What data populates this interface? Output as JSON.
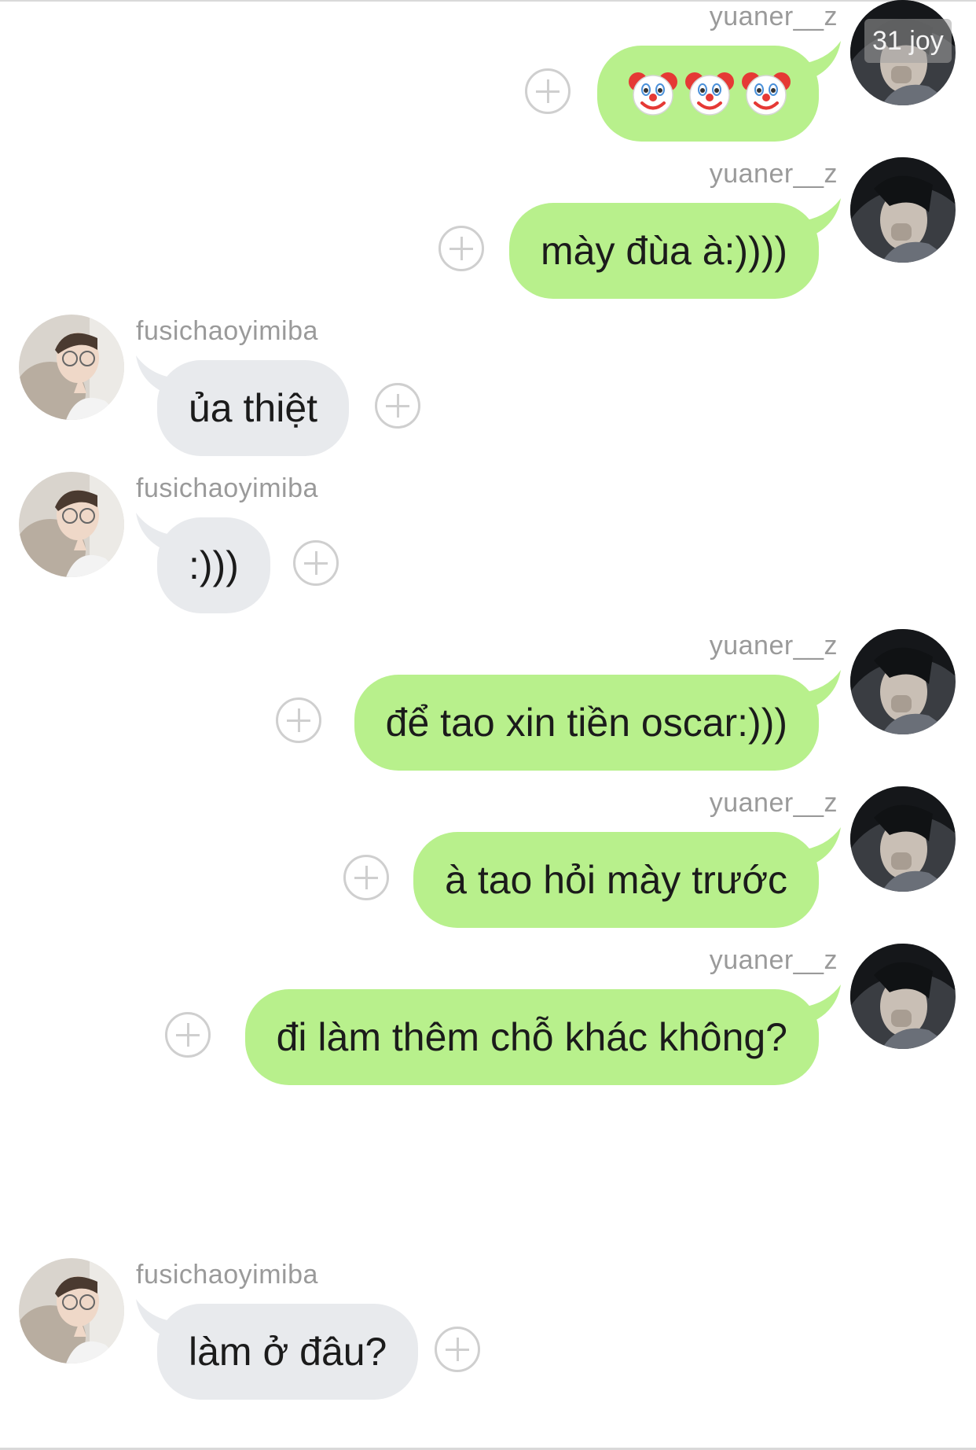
{
  "watermark": "31 joy",
  "users": {
    "me": "yuaner__z",
    "other": "fusichaoyimiba"
  },
  "messages": [
    {
      "side": "right",
      "sender": "yuaner__z",
      "text": "",
      "emoji": [
        "clown-face",
        "clown-face",
        "clown-face"
      ]
    },
    {
      "side": "right",
      "sender": "yuaner__z",
      "text": "mày đùa à:))))"
    },
    {
      "side": "left",
      "sender": "fusichaoyimiba",
      "text": "ủa thiệt"
    },
    {
      "side": "left",
      "sender": "fusichaoyimiba",
      "text": ":)))"
    },
    {
      "side": "right",
      "sender": "yuaner__z",
      "text": "để tao xin tiền oscar:)))"
    },
    {
      "side": "right",
      "sender": "yuaner__z",
      "text": "à tao hỏi mày trước"
    },
    {
      "side": "right",
      "sender": "yuaner__z",
      "text": "đi làm thêm chỗ khác không?"
    },
    {
      "side": "left",
      "sender": "fusichaoyimiba",
      "text": "làm ở đâu?"
    }
  ],
  "colors": {
    "outgoing_bubble": "#b8f08c",
    "incoming_bubble": "#e8eaed",
    "username": "#9a9a9a",
    "add_reaction_icon": "#cfcfcf"
  },
  "icons": {
    "add": "plus-circle-icon",
    "reaction_emoji": "clown-face"
  }
}
